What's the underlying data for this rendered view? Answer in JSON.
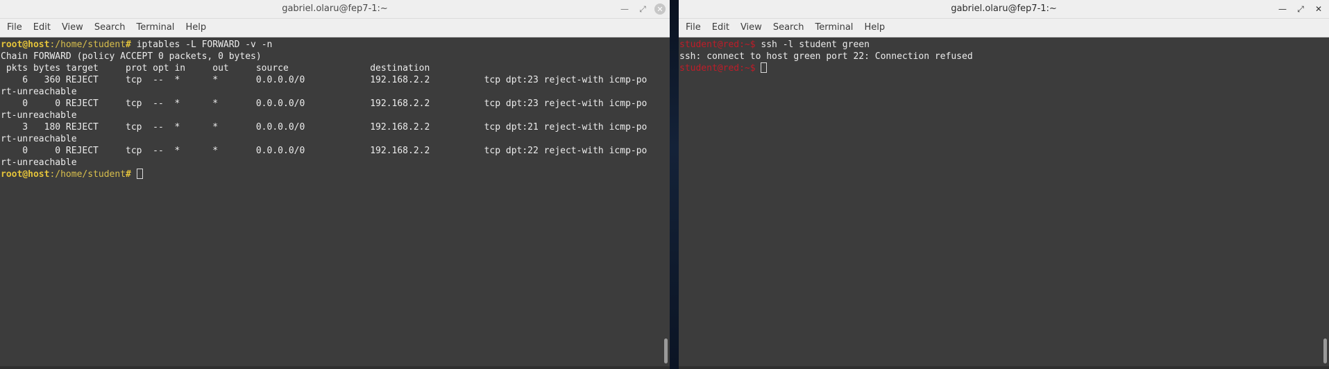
{
  "left_window": {
    "title": "gabriel.olaru@fep7-1:~",
    "menu": [
      "File",
      "Edit",
      "View",
      "Search",
      "Terminal",
      "Help"
    ],
    "prompt_user": "root@host",
    "prompt_path": ":/home/student",
    "prompt_symbol": "# ",
    "command": "iptables -L FORWARD -v -n",
    "output": [
      "Chain FORWARD (policy ACCEPT 0 packets, 0 bytes)",
      " pkts bytes target     prot opt in     out     source               destination",
      "    6   360 REJECT     tcp  --  *      *       0.0.0.0/0            192.168.2.2          tcp dpt:23 reject-with icmp-po",
      "rt-unreachable",
      "    0     0 REJECT     tcp  --  *      *       0.0.0.0/0            192.168.2.2          tcp dpt:23 reject-with icmp-po",
      "rt-unreachable",
      "    3   180 REJECT     tcp  --  *      *       0.0.0.0/0            192.168.2.2          tcp dpt:21 reject-with icmp-po",
      "rt-unreachable",
      "    0     0 REJECT     tcp  --  *      *       0.0.0.0/0            192.168.2.2          tcp dpt:22 reject-with icmp-po",
      "rt-unreachable"
    ]
  },
  "right_window": {
    "title": "gabriel.olaru@fep7-1:~",
    "menu": [
      "File",
      "Edit",
      "View",
      "Search",
      "Terminal",
      "Help"
    ],
    "prompt": "student@red:~$ ",
    "command": "ssh -l student green",
    "output": [
      "ssh: connect to host green port 22: Connection refused"
    ]
  },
  "icons": {
    "minimize": "minimize-icon",
    "maximize": "maximize-icon",
    "close": "close-icon"
  },
  "colors": {
    "terminal_bg": "#3c3c3c",
    "root_prompt": "#e4c33a",
    "student_prompt": "#c01c28",
    "titlebar_bg": "#efefef"
  }
}
